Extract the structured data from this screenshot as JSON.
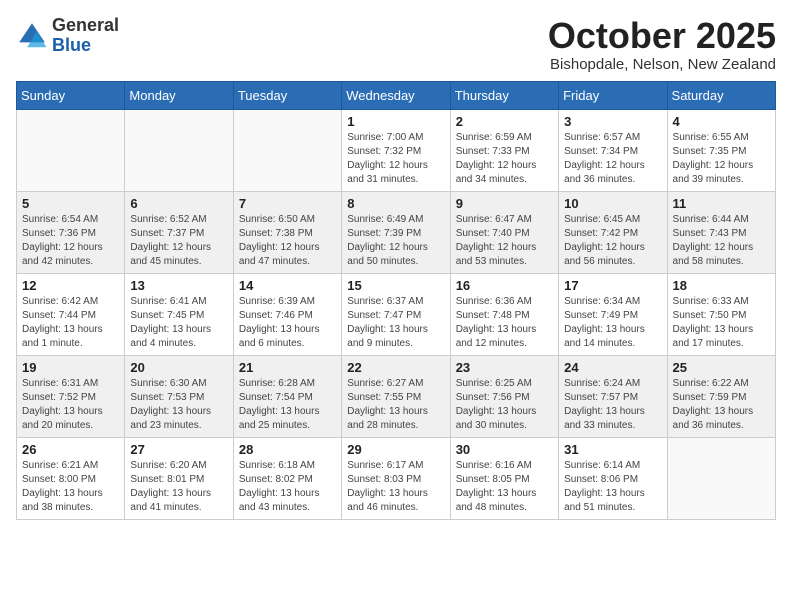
{
  "header": {
    "logo_general": "General",
    "logo_blue": "Blue",
    "month_title": "October 2025",
    "location": "Bishopdale, Nelson, New Zealand"
  },
  "weekdays": [
    "Sunday",
    "Monday",
    "Tuesday",
    "Wednesday",
    "Thursday",
    "Friday",
    "Saturday"
  ],
  "weeks": [
    [
      {
        "day": "",
        "info": ""
      },
      {
        "day": "",
        "info": ""
      },
      {
        "day": "",
        "info": ""
      },
      {
        "day": "1",
        "info": "Sunrise: 7:00 AM\nSunset: 7:32 PM\nDaylight: 12 hours\nand 31 minutes."
      },
      {
        "day": "2",
        "info": "Sunrise: 6:59 AM\nSunset: 7:33 PM\nDaylight: 12 hours\nand 34 minutes."
      },
      {
        "day": "3",
        "info": "Sunrise: 6:57 AM\nSunset: 7:34 PM\nDaylight: 12 hours\nand 36 minutes."
      },
      {
        "day": "4",
        "info": "Sunrise: 6:55 AM\nSunset: 7:35 PM\nDaylight: 12 hours\nand 39 minutes."
      }
    ],
    [
      {
        "day": "5",
        "info": "Sunrise: 6:54 AM\nSunset: 7:36 PM\nDaylight: 12 hours\nand 42 minutes."
      },
      {
        "day": "6",
        "info": "Sunrise: 6:52 AM\nSunset: 7:37 PM\nDaylight: 12 hours\nand 45 minutes."
      },
      {
        "day": "7",
        "info": "Sunrise: 6:50 AM\nSunset: 7:38 PM\nDaylight: 12 hours\nand 47 minutes."
      },
      {
        "day": "8",
        "info": "Sunrise: 6:49 AM\nSunset: 7:39 PM\nDaylight: 12 hours\nand 50 minutes."
      },
      {
        "day": "9",
        "info": "Sunrise: 6:47 AM\nSunset: 7:40 PM\nDaylight: 12 hours\nand 53 minutes."
      },
      {
        "day": "10",
        "info": "Sunrise: 6:45 AM\nSunset: 7:42 PM\nDaylight: 12 hours\nand 56 minutes."
      },
      {
        "day": "11",
        "info": "Sunrise: 6:44 AM\nSunset: 7:43 PM\nDaylight: 12 hours\nand 58 minutes."
      }
    ],
    [
      {
        "day": "12",
        "info": "Sunrise: 6:42 AM\nSunset: 7:44 PM\nDaylight: 13 hours\nand 1 minute."
      },
      {
        "day": "13",
        "info": "Sunrise: 6:41 AM\nSunset: 7:45 PM\nDaylight: 13 hours\nand 4 minutes."
      },
      {
        "day": "14",
        "info": "Sunrise: 6:39 AM\nSunset: 7:46 PM\nDaylight: 13 hours\nand 6 minutes."
      },
      {
        "day": "15",
        "info": "Sunrise: 6:37 AM\nSunset: 7:47 PM\nDaylight: 13 hours\nand 9 minutes."
      },
      {
        "day": "16",
        "info": "Sunrise: 6:36 AM\nSunset: 7:48 PM\nDaylight: 13 hours\nand 12 minutes."
      },
      {
        "day": "17",
        "info": "Sunrise: 6:34 AM\nSunset: 7:49 PM\nDaylight: 13 hours\nand 14 minutes."
      },
      {
        "day": "18",
        "info": "Sunrise: 6:33 AM\nSunset: 7:50 PM\nDaylight: 13 hours\nand 17 minutes."
      }
    ],
    [
      {
        "day": "19",
        "info": "Sunrise: 6:31 AM\nSunset: 7:52 PM\nDaylight: 13 hours\nand 20 minutes."
      },
      {
        "day": "20",
        "info": "Sunrise: 6:30 AM\nSunset: 7:53 PM\nDaylight: 13 hours\nand 23 minutes."
      },
      {
        "day": "21",
        "info": "Sunrise: 6:28 AM\nSunset: 7:54 PM\nDaylight: 13 hours\nand 25 minutes."
      },
      {
        "day": "22",
        "info": "Sunrise: 6:27 AM\nSunset: 7:55 PM\nDaylight: 13 hours\nand 28 minutes."
      },
      {
        "day": "23",
        "info": "Sunrise: 6:25 AM\nSunset: 7:56 PM\nDaylight: 13 hours\nand 30 minutes."
      },
      {
        "day": "24",
        "info": "Sunrise: 6:24 AM\nSunset: 7:57 PM\nDaylight: 13 hours\nand 33 minutes."
      },
      {
        "day": "25",
        "info": "Sunrise: 6:22 AM\nSunset: 7:59 PM\nDaylight: 13 hours\nand 36 minutes."
      }
    ],
    [
      {
        "day": "26",
        "info": "Sunrise: 6:21 AM\nSunset: 8:00 PM\nDaylight: 13 hours\nand 38 minutes."
      },
      {
        "day": "27",
        "info": "Sunrise: 6:20 AM\nSunset: 8:01 PM\nDaylight: 13 hours\nand 41 minutes."
      },
      {
        "day": "28",
        "info": "Sunrise: 6:18 AM\nSunset: 8:02 PM\nDaylight: 13 hours\nand 43 minutes."
      },
      {
        "day": "29",
        "info": "Sunrise: 6:17 AM\nSunset: 8:03 PM\nDaylight: 13 hours\nand 46 minutes."
      },
      {
        "day": "30",
        "info": "Sunrise: 6:16 AM\nSunset: 8:05 PM\nDaylight: 13 hours\nand 48 minutes."
      },
      {
        "day": "31",
        "info": "Sunrise: 6:14 AM\nSunset: 8:06 PM\nDaylight: 13 hours\nand 51 minutes."
      },
      {
        "day": "",
        "info": ""
      }
    ]
  ]
}
